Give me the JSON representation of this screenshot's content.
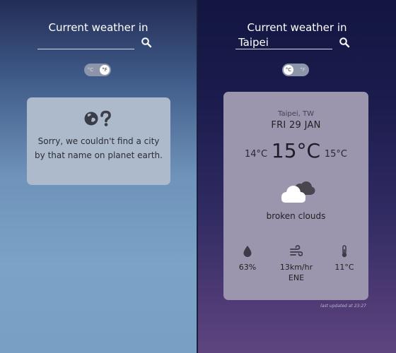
{
  "left_panel": {
    "heading": "Current weather in",
    "search_value": "",
    "units": {
      "celsius": "°C",
      "fahrenheit": "°F",
      "active": "fahrenheit"
    },
    "error": {
      "icon": "globe-question-icon",
      "line1": "Sorry, we couldn't find a city",
      "line2": "by that name on planet earth."
    }
  },
  "right_panel": {
    "heading": "Current weather in",
    "search_value": "Taipei",
    "units": {
      "celsius": "°C",
      "fahrenheit": "°F",
      "active": "celsius"
    },
    "weather": {
      "location": "Taipei, TW",
      "date": "FRI 29 JAN",
      "temp_min": "14°C",
      "temp_current": "15°C",
      "temp_max": "15°C",
      "condition_icon": "broken-clouds-icon",
      "condition": "broken clouds",
      "humidity": "63%",
      "humidity_icon": "droplet-icon",
      "wind_speed": "13km/hr",
      "wind_direction": "ENE",
      "wind_icon": "wind-icon",
      "feels_like": "11°C",
      "feels_like_icon": "thermometer-icon"
    },
    "last_updated": "last updated at 23:27"
  },
  "colors": {
    "error_card": "#adbacb",
    "weather_card": "#9b95ad",
    "toggle_track": "#8c95aa"
  }
}
